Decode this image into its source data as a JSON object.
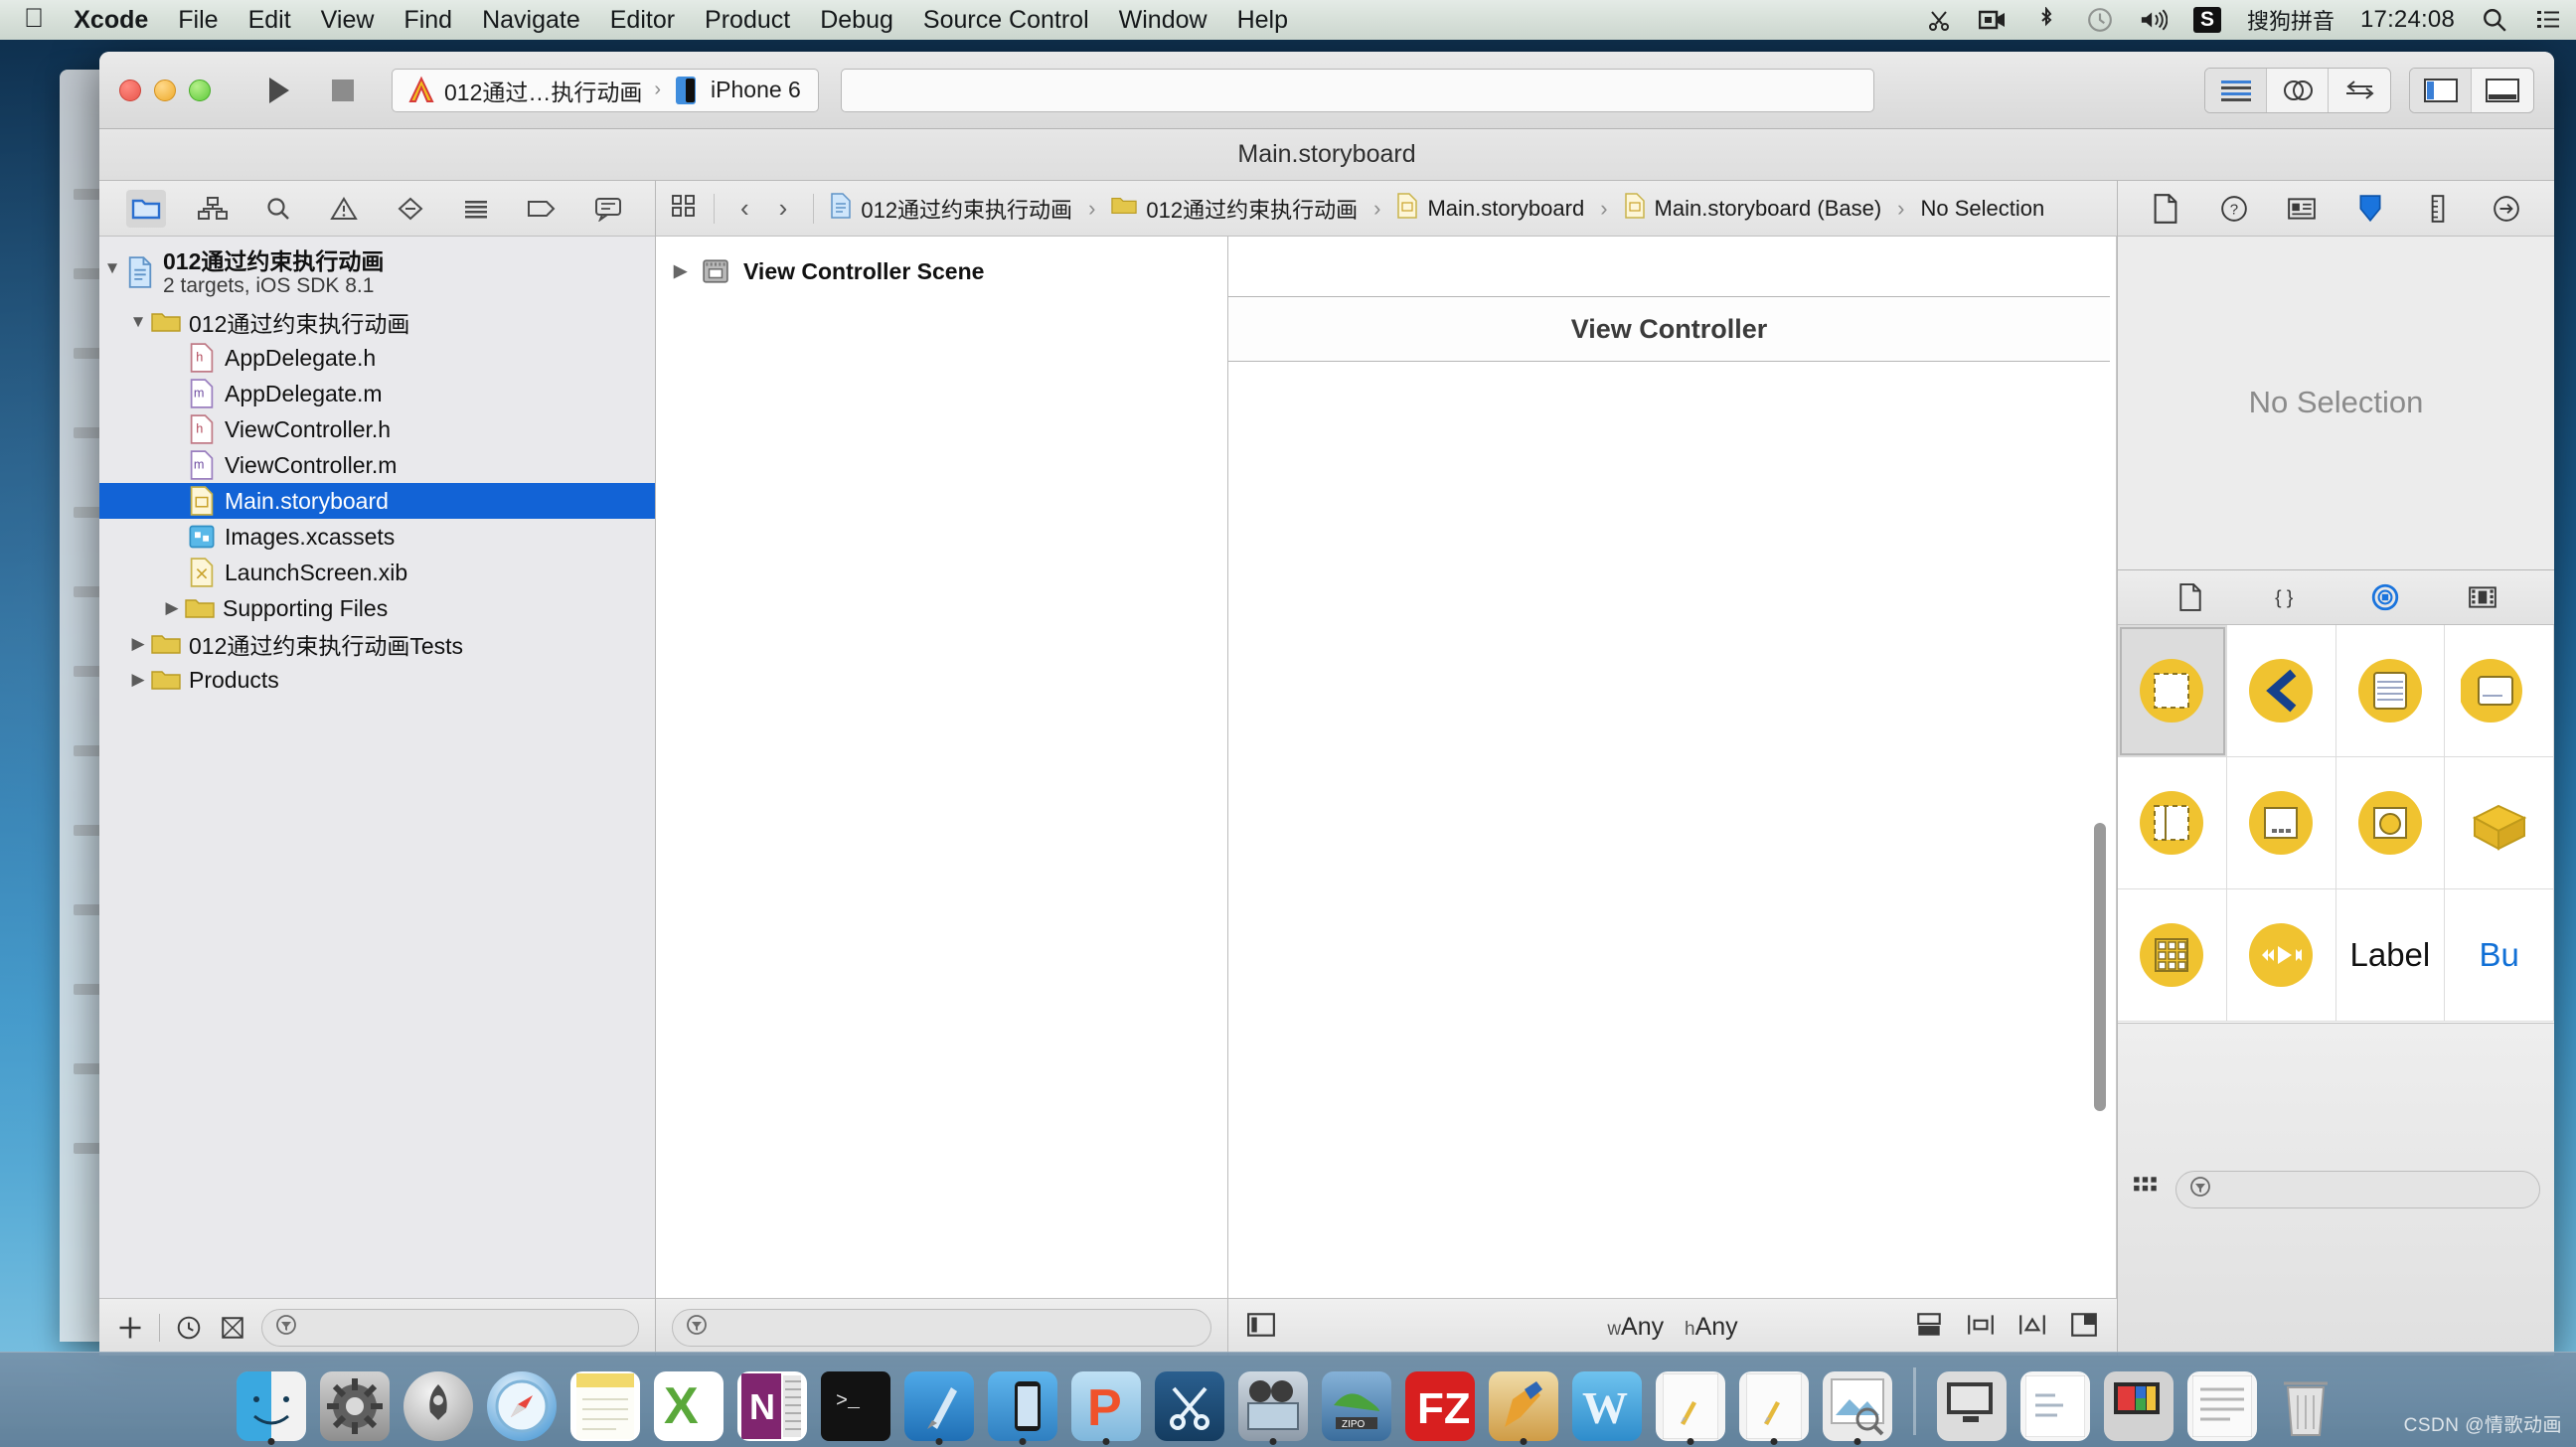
{
  "menubar": {
    "apple_icon": "apple-logo-icon",
    "items": [
      {
        "label": "Xcode",
        "bold": true
      },
      {
        "label": "File",
        "bold": false
      },
      {
        "label": "Edit",
        "bold": false
      },
      {
        "label": "View",
        "bold": false
      },
      {
        "label": "Find",
        "bold": false
      },
      {
        "label": "Navigate",
        "bold": false
      },
      {
        "label": "Editor",
        "bold": false
      },
      {
        "label": "Product",
        "bold": false
      },
      {
        "label": "Debug",
        "bold": false
      },
      {
        "label": "Source Control",
        "bold": false
      },
      {
        "label": "Window",
        "bold": false
      },
      {
        "label": "Help",
        "bold": false
      }
    ],
    "status_icons": [
      "scissors-icon",
      "screen-record-icon",
      "bluetooth-icon",
      "time-machine-icon",
      "volume-icon"
    ],
    "input_method_badge": "S",
    "input_method_label": "搜狗拼音",
    "clock": "17:24:08",
    "search_icon": "search-icon",
    "notification_icon": "notification-list-icon"
  },
  "window": {
    "title": "Main.storyboard"
  },
  "toolbar": {
    "run_button": "run-icon",
    "stop_button": "stop-icon",
    "scheme_name": "012通过…执行动画",
    "scheme_separator": "›",
    "destination": "iPhone 6",
    "omnibar_placeholder": "",
    "editor_modes": [
      "standard-editor-icon",
      "assistant-editor-icon",
      "version-editor-icon"
    ],
    "view_toggles": [
      "navigator-toggle-icon",
      "utilities-toggle-icon"
    ]
  },
  "navigator": {
    "tabs": [
      "project-navigator-icon",
      "symbol-navigator-icon",
      "search-navigator-icon",
      "issue-navigator-icon",
      "test-navigator-icon",
      "debug-navigator-icon",
      "breakpoint-navigator-icon",
      "report-navigator-icon"
    ],
    "selected_tab_index": 0,
    "tree": [
      {
        "indent": 0,
        "disclosure": "down",
        "icon": "project-file-icon",
        "label": "012通过约束执行动画",
        "sublabel": "2 targets, iOS SDK 8.1",
        "bold": true,
        "selected": false
      },
      {
        "indent": 1,
        "disclosure": "down",
        "icon": "folder-icon",
        "label": "012通过约束执行动画",
        "sublabel": "",
        "bold": false,
        "selected": false
      },
      {
        "indent": 2,
        "disclosure": "none",
        "icon": "header-file-icon",
        "label": "AppDelegate.h",
        "sublabel": "",
        "bold": false,
        "selected": false
      },
      {
        "indent": 2,
        "disclosure": "none",
        "icon": "source-file-icon",
        "label": "AppDelegate.m",
        "sublabel": "",
        "bold": false,
        "selected": false
      },
      {
        "indent": 2,
        "disclosure": "none",
        "icon": "header-file-icon",
        "label": "ViewController.h",
        "sublabel": "",
        "bold": false,
        "selected": false
      },
      {
        "indent": 2,
        "disclosure": "none",
        "icon": "source-file-icon",
        "label": "ViewController.m",
        "sublabel": "",
        "bold": false,
        "selected": false
      },
      {
        "indent": 2,
        "disclosure": "none",
        "icon": "storyboard-file-icon",
        "label": "Main.storyboard",
        "sublabel": "",
        "bold": false,
        "selected": true
      },
      {
        "indent": 2,
        "disclosure": "none",
        "icon": "xcassets-icon",
        "label": "Images.xcassets",
        "sublabel": "",
        "bold": false,
        "selected": false
      },
      {
        "indent": 2,
        "disclosure": "none",
        "icon": "xib-file-icon",
        "label": "LaunchScreen.xib",
        "sublabel": "",
        "bold": false,
        "selected": false
      },
      {
        "indent": 2,
        "disclosure": "right",
        "icon": "folder-icon",
        "label": "Supporting Files",
        "sublabel": "",
        "bold": false,
        "selected": false
      },
      {
        "indent": 1,
        "disclosure": "right",
        "icon": "folder-icon",
        "label": "012通过约束执行动画Tests",
        "sublabel": "",
        "bold": false,
        "selected": false
      },
      {
        "indent": 1,
        "disclosure": "right",
        "icon": "folder-icon",
        "label": "Products",
        "sublabel": "",
        "bold": false,
        "selected": false
      }
    ],
    "footer": {
      "add_button": "add-plus-icon",
      "recent_button": "recent-clock-icon",
      "source-control_button": "source-control-icon",
      "filter_placeholder": ""
    }
  },
  "jumpbar": {
    "related_items_icon": "related-items-icon",
    "back_icon": "chevron-left-icon",
    "forward_icon": "chevron-right-icon",
    "crumbs": [
      {
        "icon": "project-file-icon",
        "label": "012通过约束执行动画"
      },
      {
        "icon": "folder-icon",
        "label": "012通过约束执行动画"
      },
      {
        "icon": "storyboard-file-icon",
        "label": "Main.storyboard"
      },
      {
        "icon": "storyboard-file-icon",
        "label": "Main.storyboard (Base)"
      },
      {
        "icon": "none",
        "label": "No Selection"
      }
    ],
    "separator": "›"
  },
  "outline": {
    "rows": [
      {
        "disclosure": "right",
        "icon": "view-controller-scene-icon",
        "label": "View Controller Scene"
      }
    ],
    "footer_filter_placeholder": ""
  },
  "canvas": {
    "scene_title": "View Controller",
    "cursor_icon": "mouse-pointer-icon",
    "footer": {
      "document_outline_toggle": "document-outline-icon",
      "size_class_w": "w",
      "size_class_w_value": "Any",
      "size_class_h": "h",
      "size_class_h_value": "Any",
      "size_class_text": "wAny hAny",
      "constraint_buttons": [
        "stack-icon",
        "align-icon",
        "pin-icon",
        "resolve-issues-icon"
      ]
    }
  },
  "utilities": {
    "inspector_tabs": [
      "file-inspector-icon",
      "quick-help-icon",
      "identity-inspector-icon",
      "attributes-inspector-icon",
      "size-inspector-icon",
      "connections-inspector-icon"
    ],
    "selected_inspector_index": 3,
    "inspector_message": "No Selection",
    "library_tabs": [
      "file-template-library-icon",
      "code-snippet-library-icon",
      "object-library-icon",
      "media-library-icon"
    ],
    "selected_library_index": 2,
    "library_items": [
      {
        "name": "view-object-icon",
        "label": "",
        "selected": true
      },
      {
        "name": "navigation-bar-back-icon",
        "label": "",
        "selected": false
      },
      {
        "name": "table-view-object-icon",
        "label": "",
        "selected": false
      },
      {
        "name": "table-view-cell-icon",
        "label": "",
        "selected": false
      },
      {
        "name": "split-view-object-icon",
        "label": "",
        "selected": false
      },
      {
        "name": "toolbar-object-icon",
        "label": "",
        "selected": false
      },
      {
        "name": "image-view-object-icon",
        "label": "",
        "selected": false
      },
      {
        "name": "container-object-icon",
        "label": "",
        "selected": false
      },
      {
        "name": "collection-view-object-icon",
        "label": "",
        "selected": false
      },
      {
        "name": "player-controls-object-icon",
        "label": "",
        "selected": false
      },
      {
        "name": "label-object",
        "label": "Label",
        "selected": false
      },
      {
        "name": "button-object",
        "label": "Bu",
        "selected": false
      }
    ],
    "library_footer": {
      "layout_toggle": "grid-layout-icon",
      "filter_placeholder": ""
    }
  },
  "dock": {
    "items": [
      {
        "name": "finder-icon",
        "running": true
      },
      {
        "name": "system-preferences-icon",
        "running": false
      },
      {
        "name": "launchpad-icon",
        "running": false
      },
      {
        "name": "safari-icon",
        "running": false
      },
      {
        "name": "notes-icon",
        "running": false
      },
      {
        "name": "excel-icon",
        "running": false
      },
      {
        "name": "onenote-icon",
        "running": false
      },
      {
        "name": "terminal-icon",
        "running": false
      },
      {
        "name": "xcode-icon",
        "running": true
      },
      {
        "name": "simulator-icon",
        "running": true
      },
      {
        "name": "pycharm-icon",
        "running": true
      },
      {
        "name": "snipaste-icon",
        "running": false
      },
      {
        "name": "movie-icon",
        "running": true
      },
      {
        "name": "zip-icon",
        "running": false
      },
      {
        "name": "filezilla-icon",
        "running": false
      },
      {
        "name": "paint-icon",
        "running": true
      },
      {
        "name": "word-icon",
        "running": false
      },
      {
        "name": "xcode-alt-icon",
        "running": true
      },
      {
        "name": "xcode-alt2-icon",
        "running": true
      },
      {
        "name": "preview-icon",
        "running": true
      }
    ],
    "stack_items": [
      {
        "name": "desktop-stack-icon"
      },
      {
        "name": "document-stack-icon"
      },
      {
        "name": "screenshot-stack-icon"
      },
      {
        "name": "downloads-stack-icon"
      }
    ],
    "trash": {
      "name": "trash-icon"
    }
  },
  "watermark": {
    "text": "CSDN @情歌动画"
  }
}
